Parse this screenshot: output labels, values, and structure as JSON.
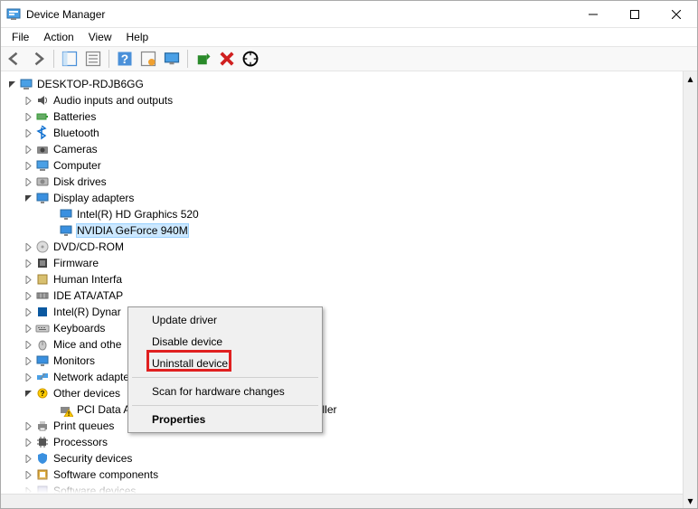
{
  "title": "Device Manager",
  "menu": {
    "file": "File",
    "action": "Action",
    "view": "View",
    "help": "Help"
  },
  "toolbar_names": {
    "back": "back-icon",
    "forward": "forward-icon",
    "showhide": "show-hide-console-tree-icon",
    "properties": "properties-icon",
    "help": "help-icon",
    "action": "action-center-icon",
    "monitor": "monitor-icon",
    "scan": "scan-hardware-icon",
    "delete": "delete-icon",
    "adddev": "add-hardware-icon"
  },
  "root": "DESKTOP-RDJB6GG",
  "categories": [
    {
      "label": "Audio inputs and outputs",
      "icon": "speaker",
      "state": "closed"
    },
    {
      "label": "Batteries",
      "icon": "battery",
      "state": "closed"
    },
    {
      "label": "Bluetooth",
      "icon": "bluetooth",
      "state": "closed"
    },
    {
      "label": "Cameras",
      "icon": "camera",
      "state": "closed"
    },
    {
      "label": "Computer",
      "icon": "computer",
      "state": "closed"
    },
    {
      "label": "Disk drives",
      "icon": "disk",
      "state": "closed"
    },
    {
      "label": "Display adapters",
      "icon": "display",
      "state": "open",
      "children": [
        {
          "label": "Intel(R) HD Graphics 520",
          "icon": "display"
        },
        {
          "label": "NVIDIA GeForce 940M",
          "icon": "display",
          "selected": true
        }
      ]
    },
    {
      "label": "DVD/CD-ROM",
      "icon": "dvd",
      "state": "closed",
      "truncated": true
    },
    {
      "label": "Firmware",
      "icon": "firmware",
      "state": "closed"
    },
    {
      "label": "Human Interfa",
      "icon": "hid",
      "state": "closed",
      "truncated": true
    },
    {
      "label": "IDE ATA/ATAP",
      "icon": "ide",
      "state": "closed",
      "truncated": true
    },
    {
      "label": "Intel(R) Dynar",
      "icon": "intel",
      "state": "closed",
      "truncated": true
    },
    {
      "label": "Keyboards",
      "icon": "keyboard",
      "state": "closed"
    },
    {
      "label": "Mice and othe",
      "icon": "mouse",
      "state": "closed",
      "truncated": true
    },
    {
      "label": "Monitors",
      "icon": "monitor",
      "state": "closed"
    },
    {
      "label": "Network adapters",
      "icon": "network",
      "state": "closed"
    },
    {
      "label": "Other devices",
      "icon": "other",
      "state": "open",
      "children": [
        {
          "label": "PCI Data Acquisition and Signal Processing Controller",
          "icon": "pci_warn"
        }
      ]
    },
    {
      "label": "Print queues",
      "icon": "printer",
      "state": "closed"
    },
    {
      "label": "Processors",
      "icon": "cpu",
      "state": "closed"
    },
    {
      "label": "Security devices",
      "icon": "security",
      "state": "closed"
    },
    {
      "label": "Software components",
      "icon": "component",
      "state": "closed"
    },
    {
      "label": "Software devices",
      "icon": "softdev",
      "state": "closed"
    }
  ],
  "context_menu": [
    {
      "label": "Update driver",
      "sep": false
    },
    {
      "label": "Disable device",
      "sep": false
    },
    {
      "label": "Uninstall device",
      "sep": true,
      "highlight": true
    },
    {
      "label": "Scan for hardware changes",
      "sep": true
    },
    {
      "label": "Properties",
      "bold": true
    }
  ]
}
